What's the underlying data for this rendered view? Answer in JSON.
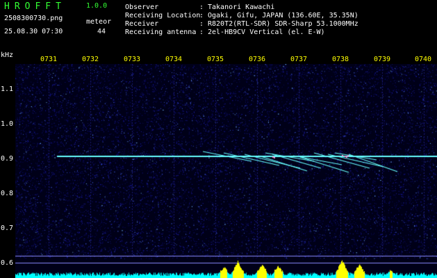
{
  "header": {
    "app_title": "HROFFT",
    "app_version": "1.0.0",
    "filename": "2508300730.png",
    "timestamp": "25.08.30 07:30",
    "meteor_label": "meteor",
    "meteor_count": "44"
  },
  "info": [
    {
      "key": "Observer",
      "value": "Takanori Kawachi"
    },
    {
      "key": "Receiving Location",
      "value": "Ogaki, Gifu, JAPAN (136.60E, 35.35N)"
    },
    {
      "key": "Receiver",
      "value": "R820T2(RTL-SDR) SDR-Sharp 53.1000MHz"
    },
    {
      "key": "Receiving antenna",
      "value": "2el-HB9CV Vertical (el. E-W)"
    }
  ],
  "info_separator": ":",
  "axis": {
    "freq_unit": "kHz",
    "time_ticks": [
      "0731",
      "0732",
      "0733",
      "0734",
      "0735",
      "0736",
      "0737",
      "0738",
      "0739",
      "0740"
    ],
    "freq_ticks": [
      "1.1",
      "1.0",
      "0.9",
      "0.8",
      "0.7",
      "0.6"
    ]
  },
  "colors": {
    "header_green": "#33ff33",
    "header_white": "#ffffff",
    "tick_yellow": "#ffff00",
    "noise_blue": "#1a1aa0",
    "carrier_cyan": "#66ffff",
    "meteor_pink": "#ff88cc",
    "histogram_cyan": "#00ffff",
    "histogram_yellow": "#ffff00"
  }
}
